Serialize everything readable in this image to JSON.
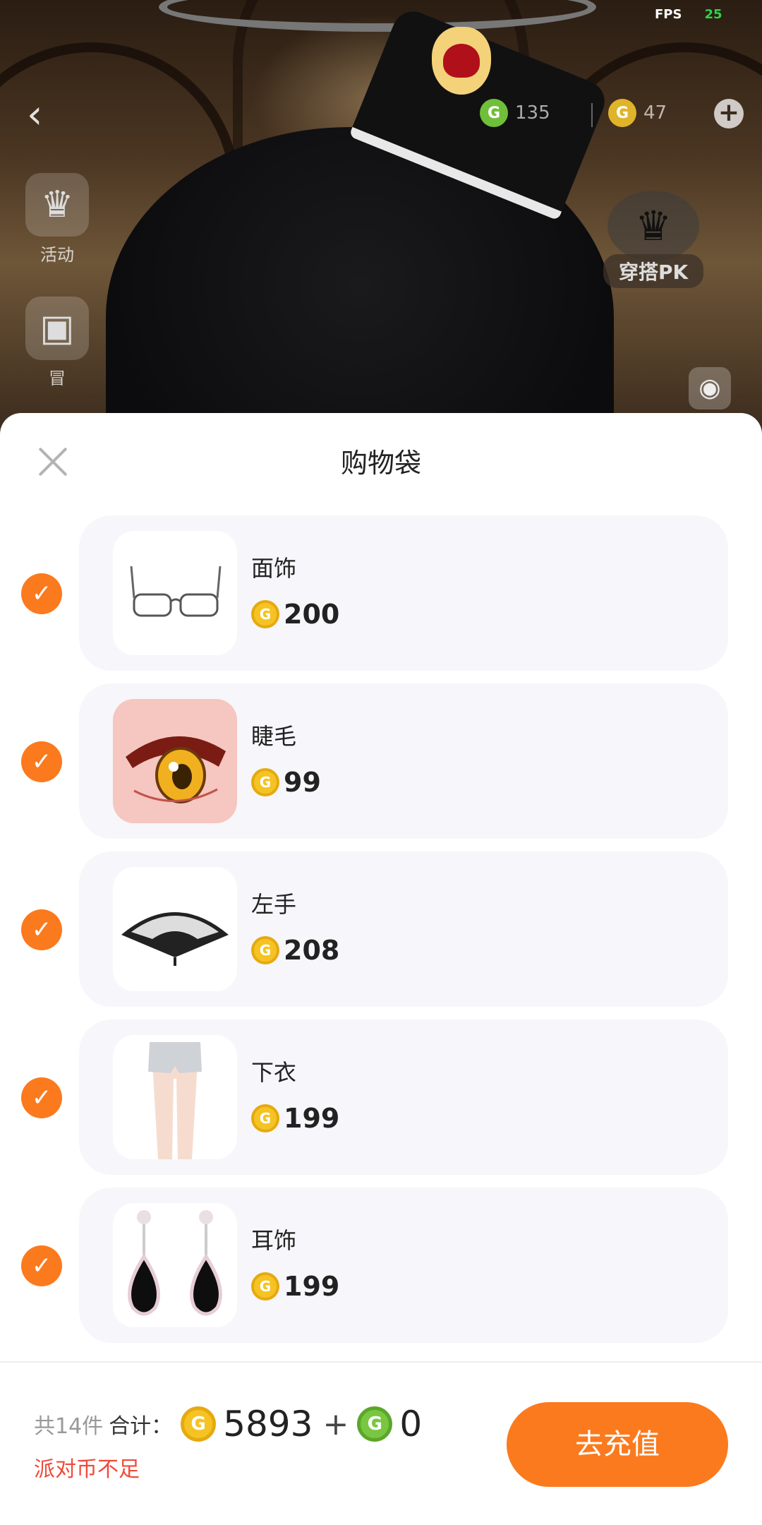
{
  "status": {
    "fps_label": "FPS",
    "fps_value": "25"
  },
  "scene": {
    "currency_green": {
      "icon": "green-g-coin-icon",
      "value": "135"
    },
    "currency_gold": {
      "icon": "gold-g-coin-icon",
      "value": "47"
    },
    "side_buttons": [
      {
        "label": "活动",
        "icon": "event-icon"
      },
      {
        "label": "冒",
        "icon": "box-icon"
      }
    ],
    "pk_label": "穿搭PK"
  },
  "sheet": {
    "title": "购物袋",
    "items": [
      {
        "name": "面饰",
        "price": "200",
        "checked": true,
        "thumb": "glasses"
      },
      {
        "name": "睫毛",
        "price": "99",
        "checked": true,
        "thumb": "eye"
      },
      {
        "name": "左手",
        "price": "208",
        "checked": true,
        "thumb": "fan"
      },
      {
        "name": "下衣",
        "price": "199",
        "checked": true,
        "thumb": "shorts"
      },
      {
        "name": "耳饰",
        "price": "199",
        "checked": true,
        "thumb": "earrings"
      }
    ]
  },
  "footer": {
    "count_text": "共14件",
    "sum_label": "合计：",
    "gold_amount": "5893",
    "plus": "+",
    "green_amount": "0",
    "warning": "派对币不足",
    "button_label": "去充值"
  },
  "colors": {
    "accent": "#fb7a1e",
    "warning": "#f04a3a",
    "card_bg": "#f7f6fa",
    "gold_coin": "#f5c324",
    "green_coin": "#79c640"
  }
}
